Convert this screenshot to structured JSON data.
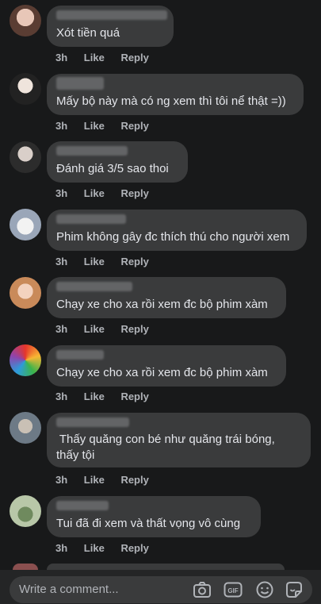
{
  "comments": [
    {
      "text": "Xót tiền quá",
      "time": "3h",
      "like": "Like",
      "reply": "Reply"
    },
    {
      "text": "Mấy bộ này mà có ng xem thì tôi nể thật =))",
      "time": "3h",
      "like": "Like",
      "reply": "Reply"
    },
    {
      "text": "Đánh giá 3/5 sao thoi",
      "time": "3h",
      "like": "Like",
      "reply": "Reply"
    },
    {
      "text": "Phim không gây đc thích thú cho người xem",
      "time": "3h",
      "like": "Like",
      "reply": "Reply"
    },
    {
      "text": "Chạy xe cho xa rồi xem đc bộ phim xàm",
      "time": "3h",
      "like": "Like",
      "reply": "Reply"
    },
    {
      "text": "Chạy xe cho xa rồi xem đc bộ phim xàm",
      "time": "3h",
      "like": "Like",
      "reply": "Reply"
    },
    {
      "text_line1": " Thấy quăng con bé như quăng trái bóng,",
      "text_line2": "thấy tội",
      "time": "3h",
      "like": "Like",
      "reply": "Reply"
    },
    {
      "text": "Tui đã đi xem và thất vọng vô cùng",
      "time": "3h",
      "like": "Like",
      "reply": "Reply"
    }
  ],
  "composer": {
    "placeholder": "Write a comment...",
    "icons": [
      "camera-icon",
      "gif-icon",
      "emoji-icon",
      "sticker-icon"
    ],
    "gif_label": "GIF"
  }
}
